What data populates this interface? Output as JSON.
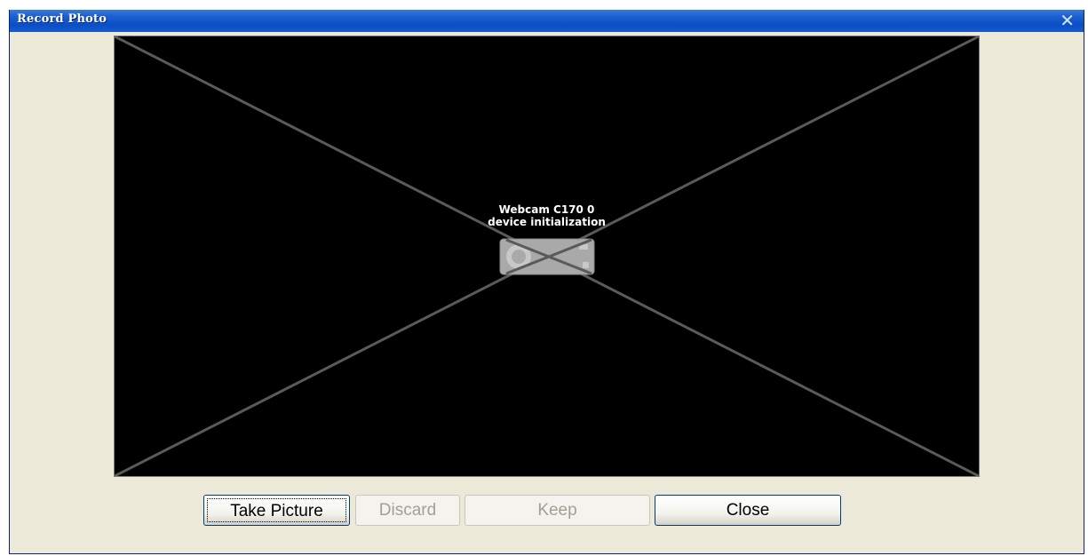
{
  "window": {
    "title": "Record Photo",
    "close_glyph": "✕"
  },
  "preview": {
    "status_line1": "Webcam C170 0",
    "status_line2": "device initialization",
    "icon": "webcam-icon"
  },
  "buttons": {
    "take_picture": "Take Picture",
    "discard": "Discard",
    "keep": "Keep",
    "close": "Close"
  },
  "colors": {
    "titlebar": "#0b4ec5",
    "window_bg": "#ece9d8",
    "preview_bg": "#000000",
    "cross_lines": "#5a5a5a",
    "disabled_text": "#a3a091"
  }
}
